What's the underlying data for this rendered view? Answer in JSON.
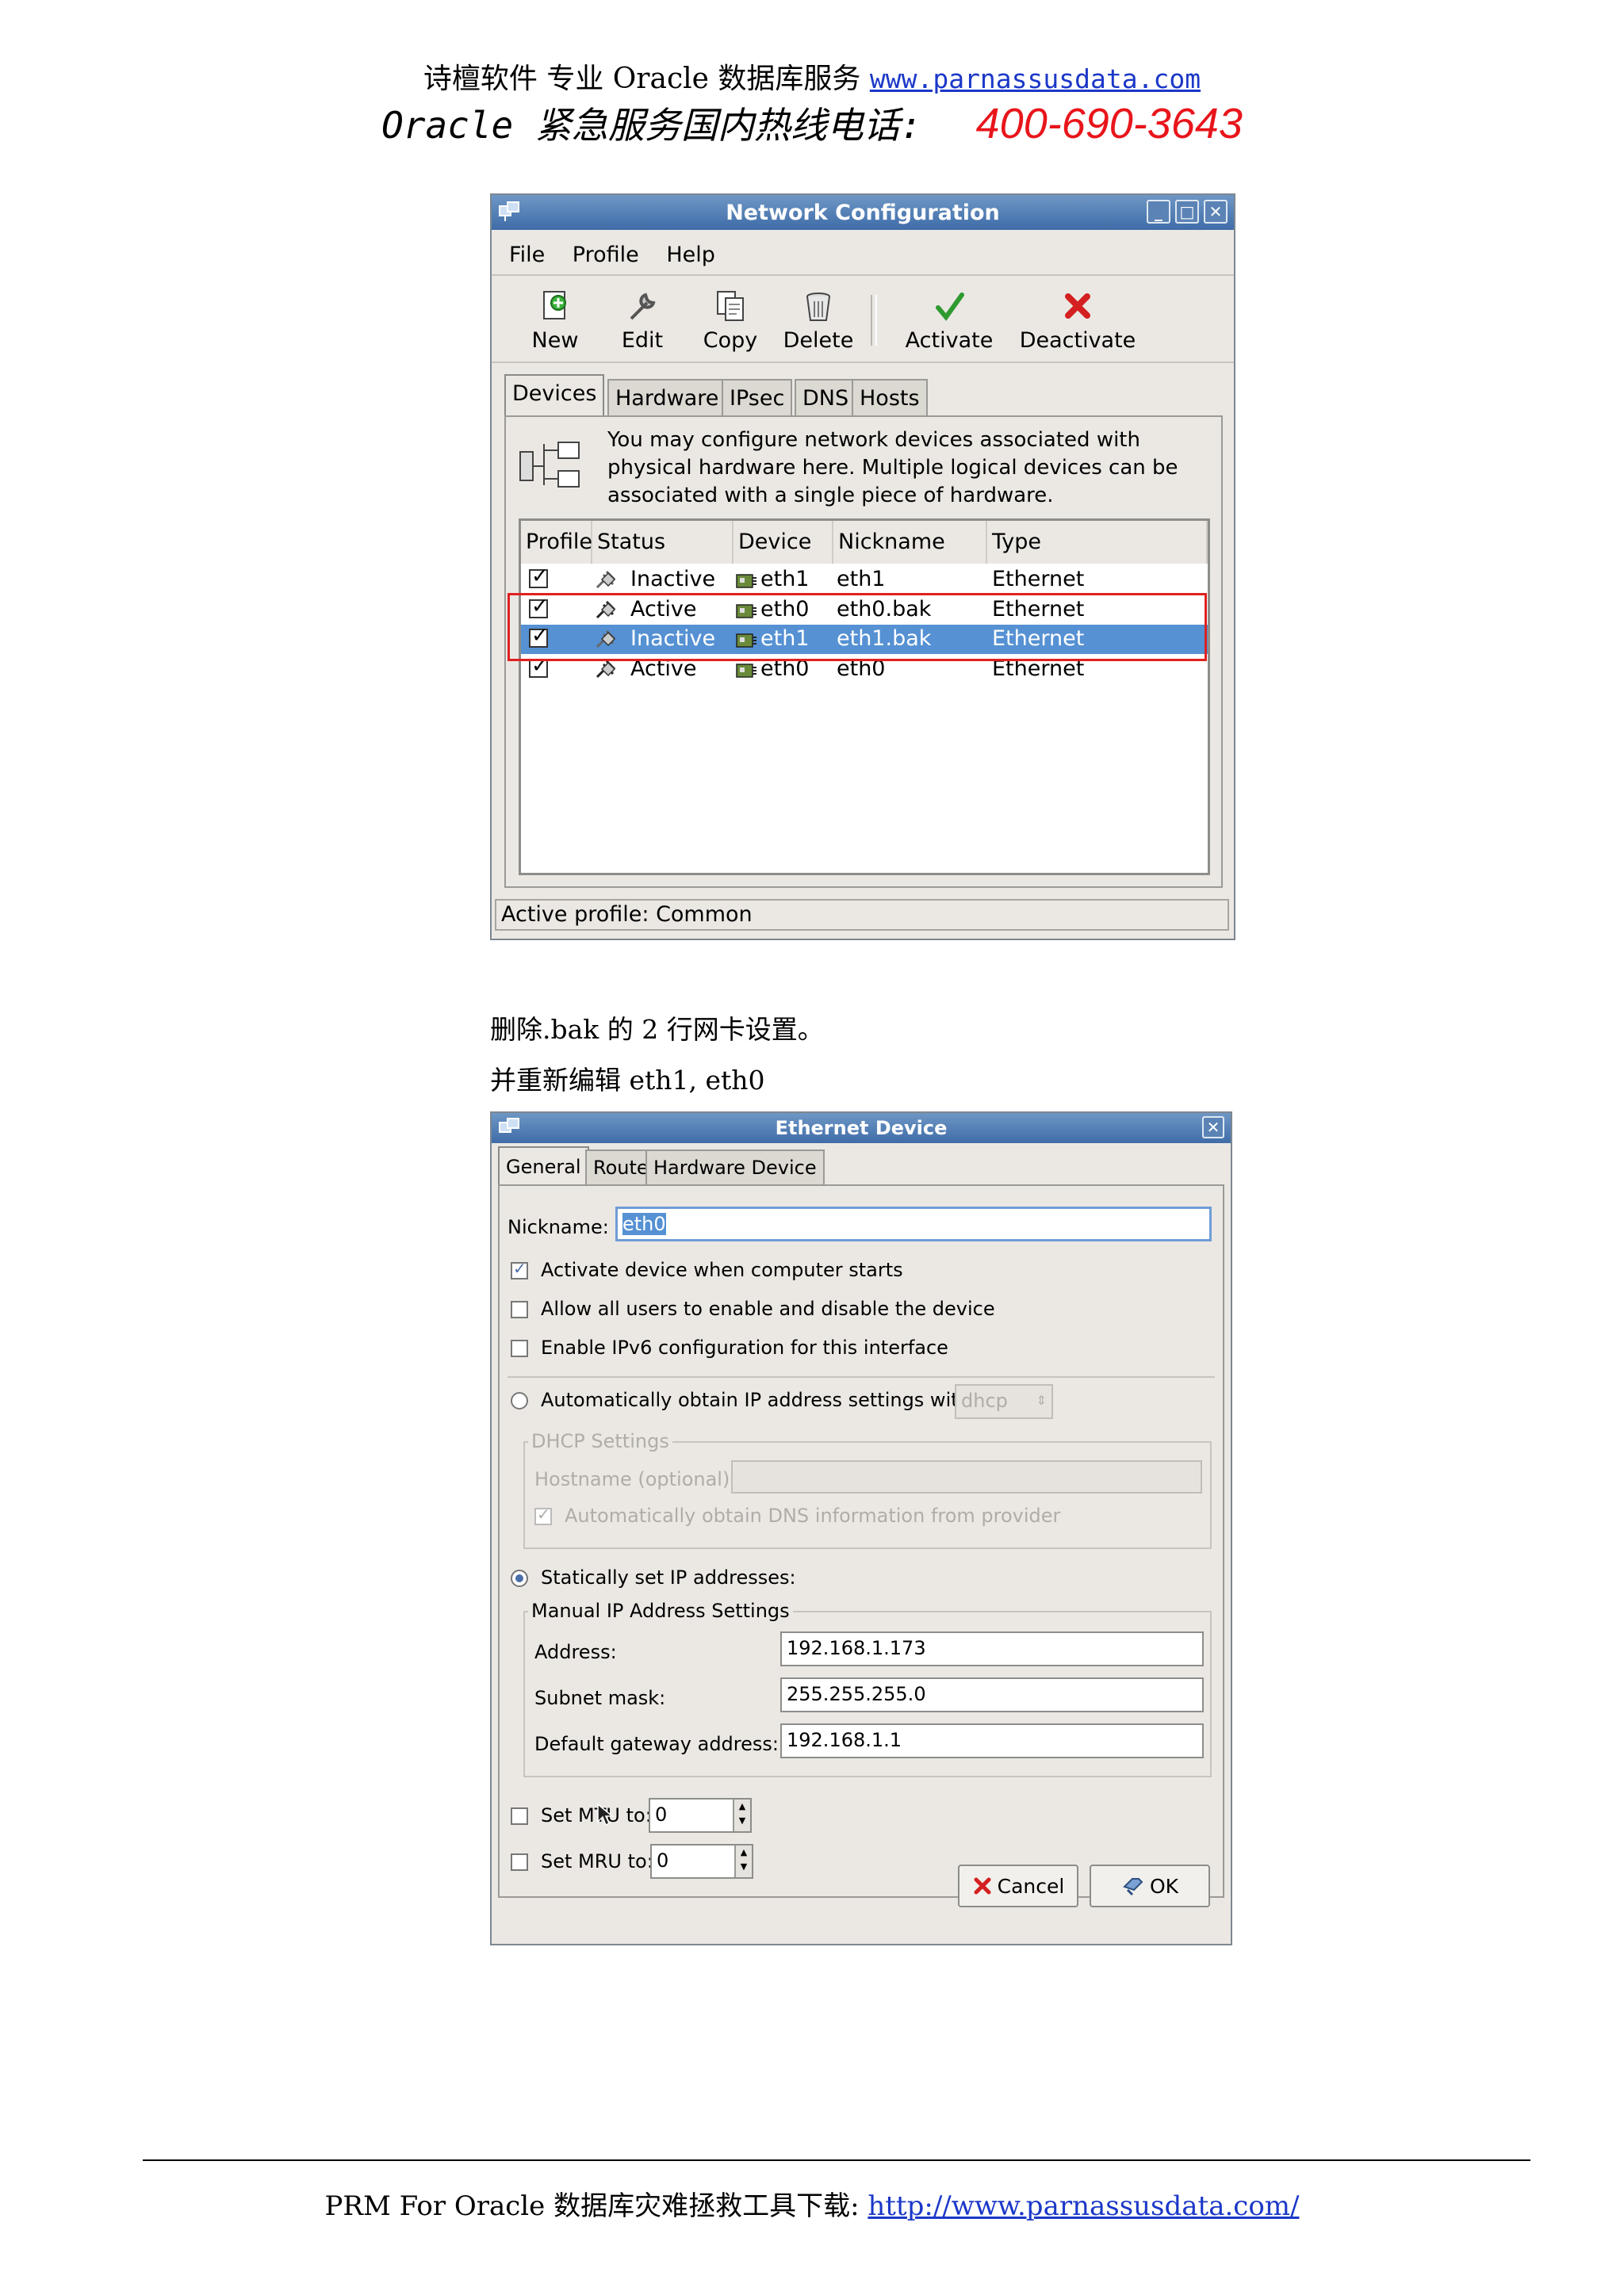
{
  "header": {
    "line1_text": "诗檀软件 专业 Oracle 数据库服务",
    "line1_url": "www.parnassusdata.com",
    "line2_text": "Oracle 紧急服务国内热线电话:",
    "phone": "400-690-3643",
    "phone_color": "#e8151b",
    "link_color": "#1b38c8"
  },
  "network_window": {
    "title": "Network Configuration",
    "menu": [
      "File",
      "Profile",
      "Help"
    ],
    "toolbar": [
      {
        "label": "New",
        "icon": "new-icon"
      },
      {
        "label": "Edit",
        "icon": "edit-icon"
      },
      {
        "label": "Copy",
        "icon": "copy-icon"
      },
      {
        "label": "Delete",
        "icon": "delete-icon"
      },
      {
        "label": "Activate",
        "icon": "activate-icon"
      },
      {
        "label": "Deactivate",
        "icon": "deactivate-icon"
      }
    ],
    "tabs": [
      "Devices",
      "Hardware",
      "IPsec",
      "DNS",
      "Hosts"
    ],
    "active_tab": "Devices",
    "description": [
      "You may configure network devices associated with",
      "physical hardware here.  Multiple logical devices can be",
      "associated with a single piece of hardware."
    ],
    "columns": [
      "Profile",
      "Status",
      "Device",
      "Nickname",
      "Type"
    ],
    "rows": [
      {
        "profile_checked": true,
        "status": "Inactive",
        "device": "eth1",
        "nickname": "eth1",
        "type": "Ethernet",
        "selected": false
      },
      {
        "profile_checked": true,
        "status": "Active",
        "device": "eth0",
        "nickname": "eth0.bak",
        "type": "Ethernet",
        "selected": false
      },
      {
        "profile_checked": true,
        "status": "Inactive",
        "device": "eth1",
        "nickname": "eth1.bak",
        "type": "Ethernet",
        "selected": true
      },
      {
        "profile_checked": true,
        "status": "Active",
        "device": "eth0",
        "nickname": "eth0",
        "type": "Ethernet",
        "selected": false
      }
    ],
    "status_bar": "Active profile: Common",
    "selection_color": "#5591d3",
    "highlight_color": "#e02020"
  },
  "captions": {
    "line1": "删除.bak 的 2 行网卡设置。",
    "line2": "并重新编辑 eth1, eth0"
  },
  "ethernet_dialog": {
    "title": "Ethernet Device",
    "tabs": [
      "General",
      "Route",
      "Hardware Device"
    ],
    "active_tab": "General",
    "nickname_label": "Nickname:",
    "nickname_value": "eth0",
    "opt_activate": "Activate device when computer starts",
    "opt_activate_checked": true,
    "opt_allow_users": "Allow all users to enable and disable the device",
    "opt_allow_users_checked": false,
    "opt_ipv6": "Enable IPv6 configuration for this interface",
    "opt_ipv6_checked": false,
    "auto_ip_label": "Automatically obtain IP address settings with:",
    "auto_ip_value": "dhcp",
    "auto_ip_selected": false,
    "dhcp_legend": "DHCP Settings",
    "hostname_label": "Hostname (optional):",
    "hostname_value": "",
    "auto_dns_label": "Automatically obtain DNS information from provider",
    "auto_dns_checked": true,
    "static_label": "Statically set IP addresses:",
    "static_selected": true,
    "manual_legend": "Manual IP Address Settings",
    "address_label": "Address:",
    "address_value": "192.168.1.173",
    "subnet_label": "Subnet mask:",
    "subnet_value": "255.255.255.0",
    "gateway_label": "Default gateway address:",
    "gateway_value": "192.168.1.1",
    "mtu_label": "Set MTU to:",
    "mtu_value": "0",
    "mtu_checked": false,
    "mru_label": "Set MRU to:",
    "mru_value": "0",
    "mru_checked": false,
    "cancel_label": "Cancel",
    "ok_label": "OK"
  },
  "footer": {
    "text": "PRM For Oracle 数据库灾难拯救工具下载:",
    "url": "http://www.parnassusdata.com/"
  }
}
